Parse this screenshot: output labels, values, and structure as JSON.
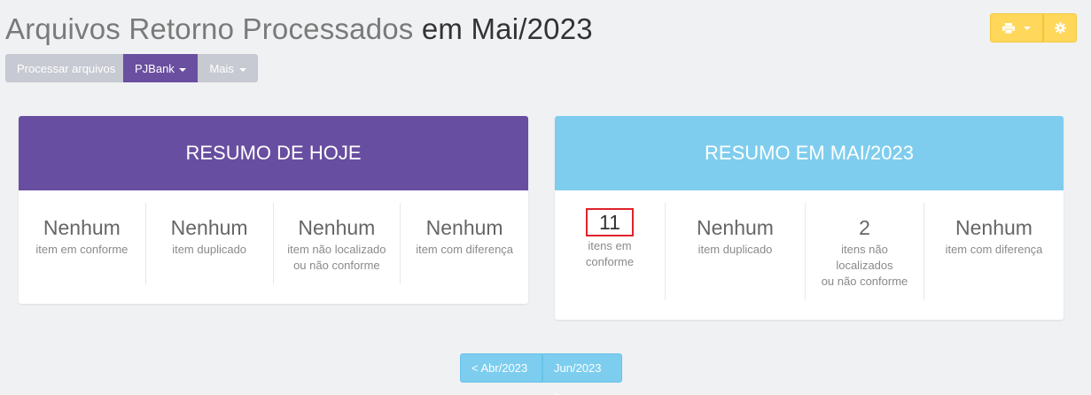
{
  "header": {
    "title_part1": "Arquivos Retorno Processados",
    "title_part2": " em Mai/2023"
  },
  "toolbar": {
    "process_label": "Processar arquivos",
    "bank_label": "PJBank",
    "more_label": "Mais"
  },
  "tools": {
    "print_icon": "print-icon",
    "settings_icon": "gear-icon"
  },
  "today": {
    "title": "RESUMO DE HOJE",
    "stats": [
      {
        "value": "Nenhum",
        "label": "item em conforme"
      },
      {
        "value": "Nenhum",
        "label": "item duplicado"
      },
      {
        "value": "Nenhum",
        "label_line1": "item não localizado",
        "label_line2": "ou não conforme"
      },
      {
        "value": "Nenhum",
        "label": "item com diferença"
      }
    ]
  },
  "month": {
    "title": "RESUMO EM MAI/2023",
    "stats": [
      {
        "value": "11",
        "label_line1": "itens em",
        "label_line2": "conforme"
      },
      {
        "value": "Nenhum",
        "label": "item duplicado"
      },
      {
        "value": "2",
        "label_line1": "itens não",
        "label_line2": "localizados",
        "label_line3": "ou não conforme"
      },
      {
        "value": "Nenhum",
        "label": "item com diferença"
      }
    ]
  },
  "pager": {
    "prev_label": "< Abr/2023",
    "next_label": "Jun/2023 >"
  },
  "colors": {
    "purple": "#684ea0",
    "blue": "#7fcdee",
    "yellow": "#ffd75a",
    "highlight": "#e0232b"
  }
}
